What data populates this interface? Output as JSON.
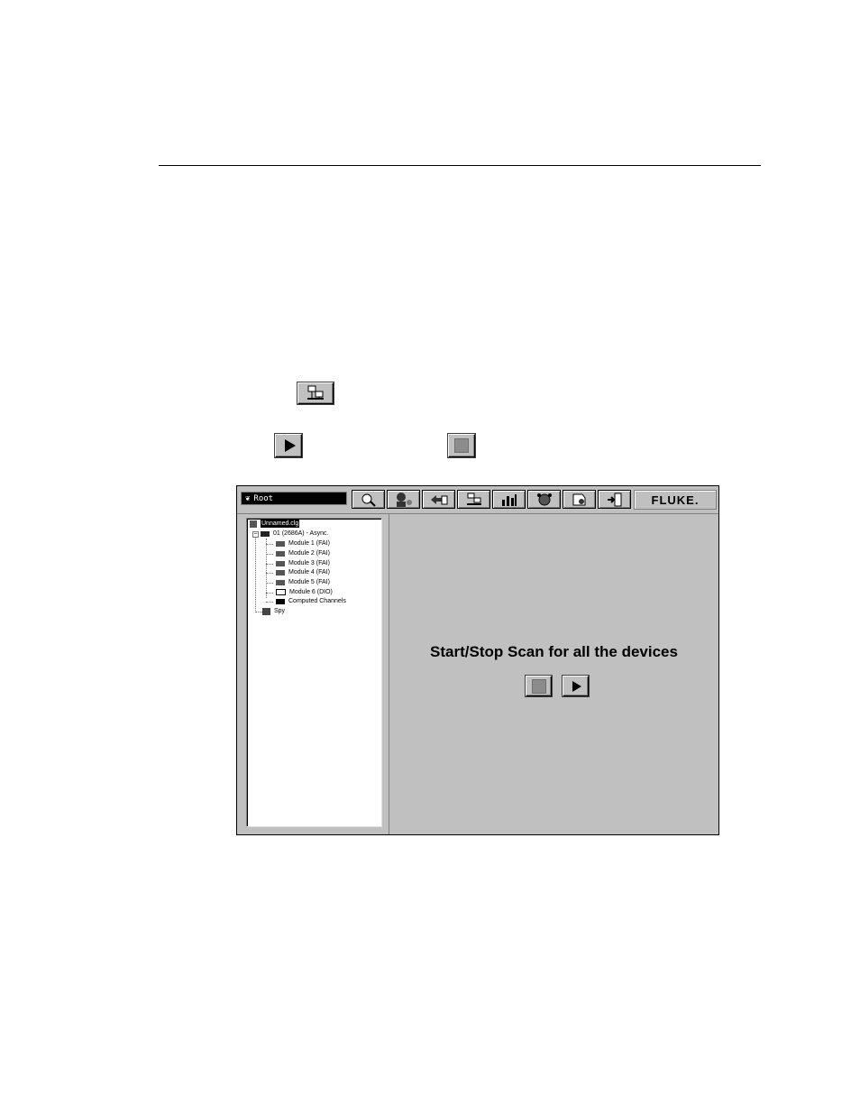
{
  "icons": {
    "hardware_icon": "network-devices-icon",
    "play_icon": "play-icon",
    "stop_icon": "stop-icon"
  },
  "window": {
    "root_label": "Root",
    "toolbar_buttons": [
      "magnifier-icon",
      "user-config-icon",
      "transfer-icon",
      "network-devices-icon",
      "chart-icon",
      "alarm-icon",
      "log-icon",
      "exit-icon"
    ],
    "logo": "FLUKE.",
    "tree": {
      "root": "Unnamed.clg",
      "device": "01 (2686A) - Async.",
      "modules": [
        "Module 1 (FAI)",
        "Module 2 (FAI)",
        "Module 3 (FAI)",
        "Module 4 (FAI)",
        "Module 5 (FAI)",
        "Module 6 (DIO)"
      ],
      "computed": "Computed Channels",
      "spy": "Spy"
    },
    "scan_title": "Start/Stop Scan for all the devices"
  }
}
